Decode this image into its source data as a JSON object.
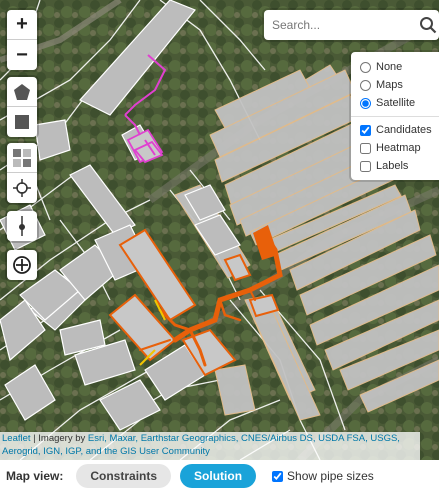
{
  "search": {
    "placeholder": "Search..."
  },
  "zoom": {
    "in_label": "+",
    "out_label": "−"
  },
  "layers": {
    "basemap_options": [
      "None",
      "Maps",
      "Satellite"
    ],
    "basemap_selected": "Satellite",
    "overlays": [
      {
        "label": "Candidates",
        "checked": true
      },
      {
        "label": "Heatmap",
        "checked": false
      },
      {
        "label": "Labels",
        "checked": false
      }
    ]
  },
  "attribution": {
    "leaflet": "Leaflet",
    "separator": " | Imagery by ",
    "providers": "Esri, Maxar, Earthstar Geographics, CNES/Airbus DS, USDA FSA, USGS, Aerogrid, IGN, IGP, and the GIS User Community"
  },
  "bottom_bar": {
    "map_view_label": "Map view:",
    "constraints_label": "Constraints",
    "solution_label": "Solution",
    "show_pipe_sizes_label": "Show pipe sizes",
    "show_pipe_sizes_checked": true,
    "active_view": "Solution"
  },
  "icons": [
    "polygon-draw-icon",
    "rectangle-draw-icon",
    "grid-icon",
    "crosshair-icon",
    "pin-icon",
    "add-location-icon",
    "search-icon"
  ],
  "colors": {
    "pipe_orange": "#e8600a",
    "pipe_magenta": "#e040d0",
    "building_fill": "#bdbdbd",
    "accent_blue": "#1aa3d9"
  }
}
